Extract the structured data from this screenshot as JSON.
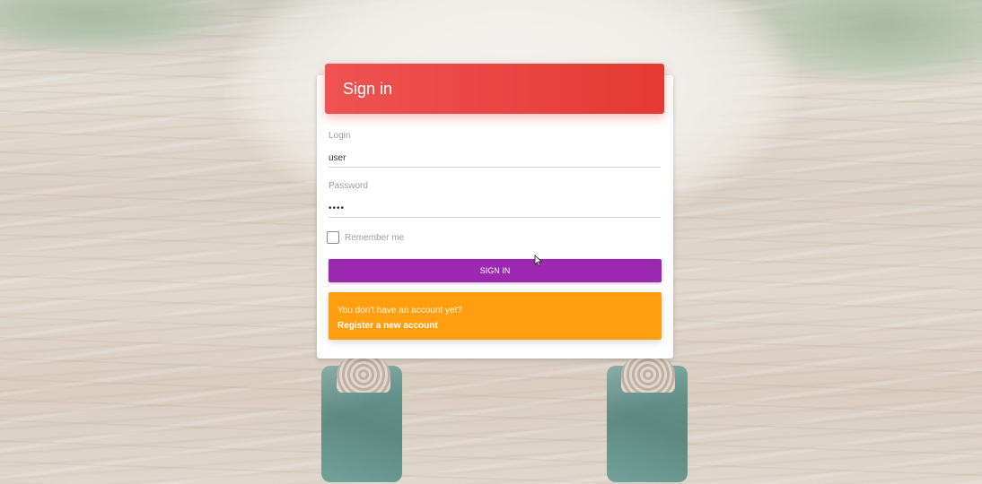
{
  "header": {
    "title": "Sign in"
  },
  "form": {
    "login_label": "Login",
    "login_value": "user",
    "password_label": "Password",
    "password_value": "user",
    "remember_label": "Remember me",
    "remember_checked": false,
    "submit_label": "Sign in"
  },
  "register": {
    "question": "You don't have an account yet?",
    "link_label": "Register a new account"
  },
  "colors": {
    "header": "#e53935",
    "submit": "#9c27b0",
    "register": "#ff9f10"
  }
}
